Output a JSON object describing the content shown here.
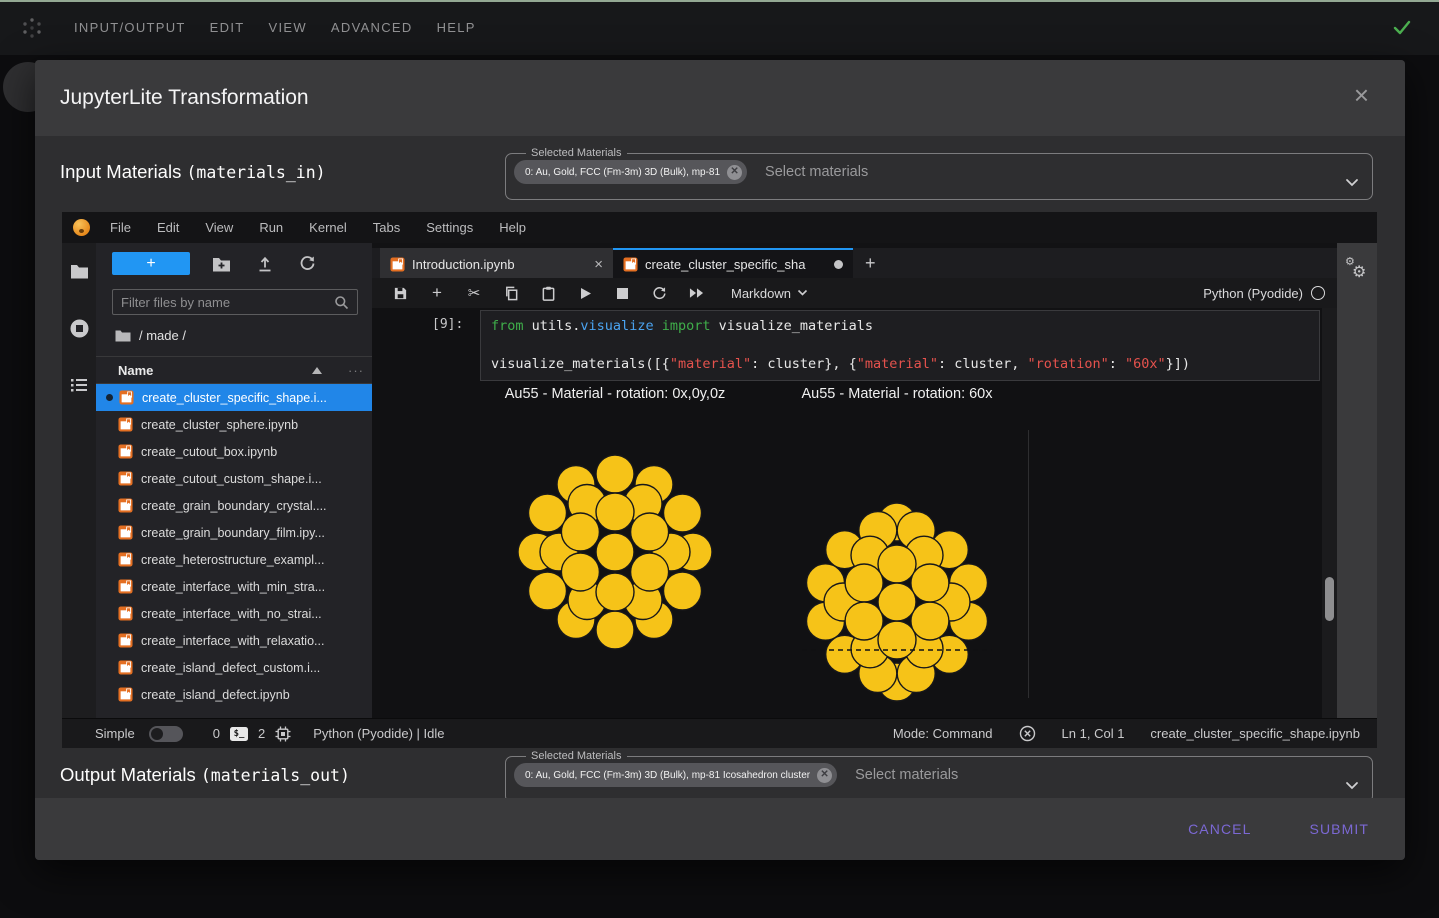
{
  "topbar": {
    "menus": [
      "INPUT/OUTPUT",
      "EDIT",
      "VIEW",
      "ADVANCED",
      "HELP"
    ],
    "check_color": "#4caf50"
  },
  "dialog": {
    "title": "JupyterLite Transformation",
    "accent_color": "#7b68d4",
    "input": {
      "label": "Input Materials ",
      "label_code": "(materials_in)",
      "legend": "Selected Materials",
      "chip": "0: Au, Gold, FCC (Fm-3m) 3D (Bulk), mp-81",
      "placeholder": "Select materials"
    },
    "output": {
      "label": "Output Materials ",
      "label_code": "(materials_out)",
      "legend": "Selected Materials",
      "chip": "0: Au, Gold, FCC (Fm-3m) 3D (Bulk), mp-81 Icosahedron cluster",
      "placeholder": "Select materials"
    },
    "cancel": "CANCEL",
    "submit": "SUBMIT"
  },
  "jupyter": {
    "menus": [
      "File",
      "Edit",
      "View",
      "Run",
      "Kernel",
      "Tabs",
      "Settings",
      "Help"
    ],
    "filebrowser": {
      "filter_placeholder": "Filter files by name",
      "breadcrumb": "/ made /",
      "name_header": "Name",
      "files": [
        {
          "name": "create_cluster_specific_shape.i...",
          "selected": true
        },
        {
          "name": "create_cluster_sphere.ipynb"
        },
        {
          "name": "create_cutout_box.ipynb"
        },
        {
          "name": "create_cutout_custom_shape.i..."
        },
        {
          "name": "create_grain_boundary_crystal...."
        },
        {
          "name": "create_grain_boundary_film.ipy..."
        },
        {
          "name": "create_heterostructure_exampl..."
        },
        {
          "name": "create_interface_with_min_stra..."
        },
        {
          "name": "create_interface_with_no_strai..."
        },
        {
          "name": "create_interface_with_relaxatio..."
        },
        {
          "name": "create_island_defect_custom.i..."
        },
        {
          "name": "create_island_defect.ipynb"
        }
      ]
    },
    "tabs": [
      {
        "label": "Introduction.ipynb",
        "active": false,
        "dirty": false
      },
      {
        "label": "create_cluster_specific_sha",
        "active": true,
        "dirty": true
      }
    ],
    "toolbar": {
      "cell_type": "Markdown",
      "kernel_name": "Python (Pyodide)"
    },
    "cell": {
      "prompt": "[9]:",
      "lines": [
        [
          [
            "from ",
            "kw"
          ],
          [
            "utils.",
            "pl"
          ],
          [
            "visualize",
            "fn"
          ],
          [
            " ",
            "pl"
          ],
          [
            "import",
            "kw"
          ],
          [
            " visualize_materials",
            "pl"
          ]
        ],
        [],
        [
          [
            "visualize_materials([{",
            "pl"
          ],
          [
            "\"material\"",
            "str"
          ],
          [
            ": cluster}, {",
            "pl"
          ],
          [
            "\"material\"",
            "str"
          ],
          [
            ": cluster, ",
            "pl"
          ],
          [
            "\"rotation\"",
            "str"
          ],
          [
            ": ",
            "pl"
          ],
          [
            "\"60x\"",
            "str"
          ],
          [
            "}])",
            "pl"
          ]
        ]
      ]
    },
    "outputs": [
      {
        "caption": "Au55 - Material - rotation: 0x,0y,0z"
      },
      {
        "caption": "Au55 - Material - rotation: 60x"
      }
    ],
    "atom_color": "#f6c318",
    "statusbar": {
      "simple": "Simple",
      "terminals": "0",
      "terminal_glyph": "$_",
      "kernels": "2",
      "kernel_status": "Python (Pyodide) | Idle",
      "mode": "Mode: Command",
      "cursor": "Ln 1, Col 1",
      "filename": "create_cluster_specific_shape.ipynb"
    }
  }
}
